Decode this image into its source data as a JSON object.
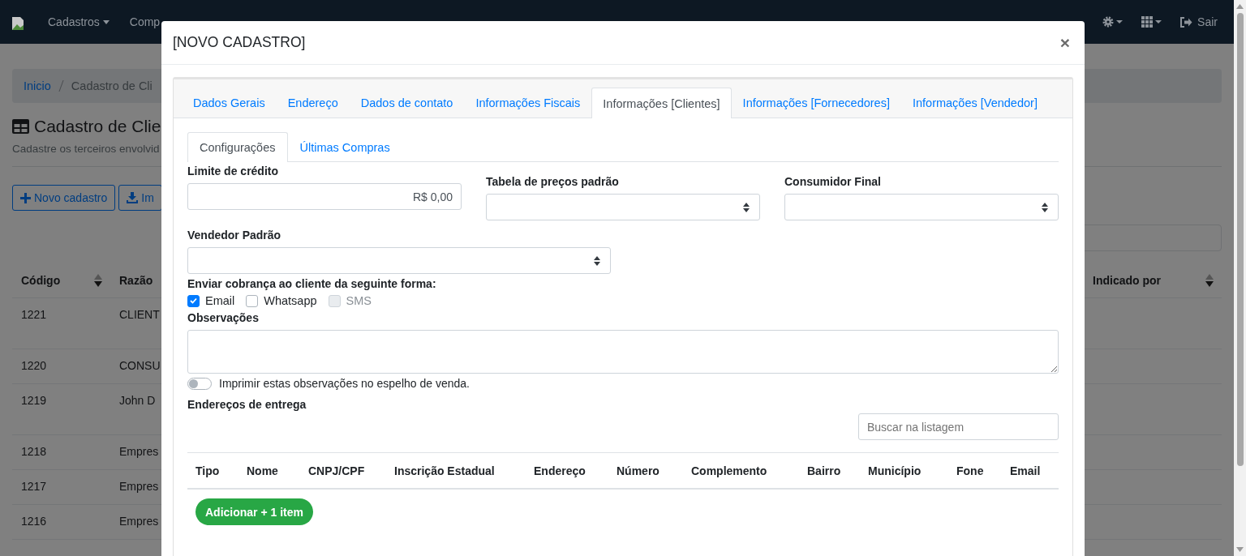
{
  "navbar": {
    "menus": [
      {
        "label": "Cadastros",
        "caret": true
      },
      {
        "label": "Comp",
        "caret": false
      }
    ],
    "actions": [
      {
        "kind": "gear"
      },
      {
        "kind": "apps"
      },
      {
        "kind": "logout",
        "label": "Sair"
      }
    ]
  },
  "background": {
    "breadcrumb": [
      {
        "label": "Inicio",
        "link": true
      },
      {
        "label": "Cadastro de Cli",
        "link": false
      }
    ],
    "title": "Cadastro de Clie",
    "subtitle": "Cadastre os terceiros envolvid",
    "buttons": [
      {
        "kind": "new",
        "label": "Novo cadastro"
      },
      {
        "kind": "import",
        "label": "Im"
      }
    ],
    "columns": [
      {
        "label": "Código",
        "sortable": true
      },
      {
        "label": "Razão"
      },
      {
        "label": "Indicado por",
        "sortable": true
      }
    ],
    "rows": [
      {
        "code": "1221",
        "name": "CLIENT",
        "tall": true
      },
      {
        "code": "1220",
        "name": "CONSU",
        "tall": false
      },
      {
        "code": "1219",
        "name": "John D",
        "tall": true
      },
      {
        "code": "1218",
        "name": "Empres",
        "tall": false
      },
      {
        "code": "1217",
        "name": "Empres",
        "tall": false
      },
      {
        "code": "1216",
        "name": "Empres",
        "tall": false
      }
    ]
  },
  "modal": {
    "title": "[NOVO CADASTRO]",
    "close": "×",
    "tabs": [
      {
        "label": "Dados Gerais",
        "selected": false
      },
      {
        "label": "Endereço",
        "selected": false
      },
      {
        "label": "Dados de contato",
        "selected": false
      },
      {
        "label": "Informações Fiscais",
        "selected": false
      },
      {
        "label": "Informações [Clientes]",
        "selected": true
      },
      {
        "label": "Informações [Fornecedores]",
        "selected": false
      },
      {
        "label": "Informações [Vendedor]",
        "selected": false
      }
    ],
    "subtabs": [
      {
        "label": "Configurações",
        "selected": true
      },
      {
        "label": "Últimas Compras",
        "selected": false
      }
    ],
    "credit_limit": {
      "label": "Limite de crédito",
      "value": "R$ 0,00"
    },
    "price_table": {
      "label": "Tabela de preços padrão"
    },
    "final_consumer": {
      "label": "Consumidor Final"
    },
    "default_seller": {
      "label": "Vendedor Padrão"
    },
    "billing": {
      "label": "Enviar cobrança ao cliente da seguinte forma:",
      "options": [
        {
          "label": "Email",
          "checked": true,
          "disabled": false
        },
        {
          "label": "Whatsapp",
          "checked": false,
          "disabled": false
        },
        {
          "label": "SMS",
          "checked": false,
          "disabled": true
        }
      ]
    },
    "notes": {
      "label": "Observações"
    },
    "print_toggle": {
      "label": "Imprimir estas observações no espelho de venda.",
      "on": false
    },
    "delivery": {
      "title": "Endereços de entrega",
      "search_placeholder": "Buscar na listagem",
      "columns": [
        "Tipo",
        "Nome",
        "CNPJ/CPF",
        "Inscrição Estadual",
        "Endereço",
        "Número",
        "Complemento",
        "Bairro",
        "Município",
        "Fone",
        "Email"
      ],
      "add_button": "Adicionar + 1 item"
    }
  }
}
